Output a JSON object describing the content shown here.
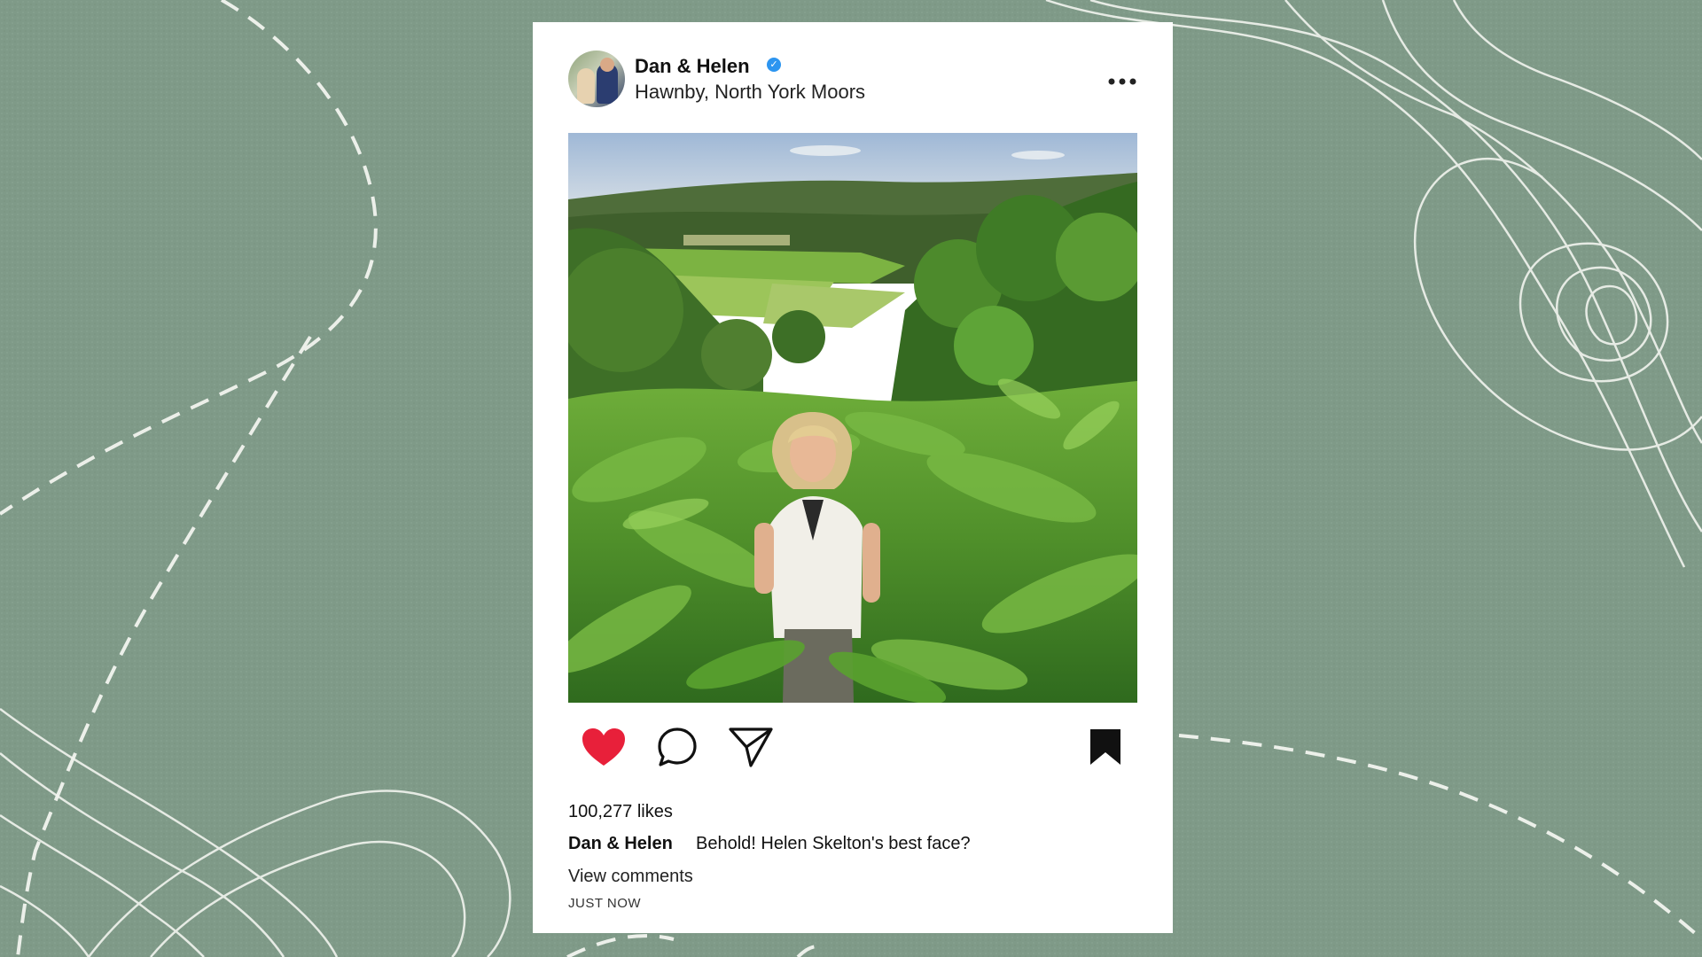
{
  "post": {
    "username": "Dan & Helen",
    "location": "Hawnby, North York Moors",
    "likes": "100,277 likes",
    "caption_user": "Dan & Helen",
    "caption_text": "Behold! Helen Skelton's best face?",
    "view_comments": "View comments",
    "timestamp": "JUST NOW",
    "liked": true
  },
  "icons": {
    "avatar": "profile-avatar",
    "verified": "verified-badge-icon",
    "more": "more-options-icon",
    "like": "heart-icon",
    "comment": "comment-icon",
    "share": "paper-plane-icon",
    "save": "bookmark-icon"
  },
  "colors": {
    "background": "#7f9a88",
    "card": "#ffffff",
    "like_red": "#e8203a",
    "verified_blue": "#2d95f0"
  }
}
